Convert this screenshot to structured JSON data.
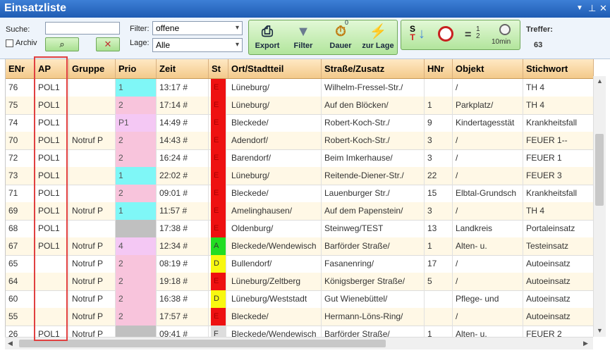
{
  "window": {
    "title": "Einsatzliste",
    "dropdown_glyph": "▼",
    "pin_glyph": "⊥",
    "close_glyph": "✕"
  },
  "toolbar": {
    "suche_label": "Suche:",
    "suche_value": "",
    "archiv_label": "Archiv",
    "filter_label": "Filter:",
    "filter_value": "offene",
    "lage_label": "Lage:",
    "lage_value": "Alle",
    "buttons": [
      {
        "label": "Export",
        "icon": "printer-icon"
      },
      {
        "label": "Filter",
        "icon": "funnel-icon"
      },
      {
        "label": "Dauer",
        "icon": "stopwatch-icon",
        "badge": "0"
      },
      {
        "label": "zur Lage",
        "icon": "lightning-icon"
      }
    ],
    "icon_buttons": [
      {
        "icon": "sort-status-icon",
        "letters": "S T"
      },
      {
        "icon": "alarm-clock-icon"
      },
      {
        "icon": "count-icon",
        "text": "1 2"
      },
      {
        "icon": "timer-icon",
        "text": "10min"
      }
    ],
    "treffer_label": "Treffer:",
    "treffer_value": "63"
  },
  "colors": {
    "prio_cyan": "#7ff7f7",
    "prio_pink": "#f8c4dc",
    "prio_violet": "#f4c8f4",
    "prio_gray": "#c0c0c0",
    "st_red": "#ee1111",
    "st_green": "#22dd22",
    "st_yellow": "#f8f811",
    "st_lightgray": "#dddddd"
  },
  "table": {
    "columns": [
      "ENr",
      "AP",
      "Gruppe",
      "Prio",
      "Zeit",
      "St",
      "Ort/Stadtteil",
      "Straße/Zusatz",
      "HNr",
      "Objekt",
      "Stichwort"
    ],
    "rows": [
      {
        "enr": "76",
        "ap": "POL1",
        "gruppe": "",
        "prio": "1",
        "prio_color": "#7ff7f7",
        "zeit": "13:17 #",
        "st": "E",
        "st_color": "#ee1111",
        "ort": "Lüneburg/",
        "strasse": "Wilhelm-Fressel-Str./",
        "hnr": "",
        "objekt": "/",
        "stichwort": "TH 4"
      },
      {
        "enr": "75",
        "ap": "POL1",
        "gruppe": "",
        "prio": "2",
        "prio_color": "#f8c4dc",
        "zeit": "17:14 #",
        "st": "E",
        "st_color": "#ee1111",
        "ort": "Lüneburg/",
        "strasse": "Auf den Blöcken/",
        "hnr": "1",
        "objekt": "Parkplatz/",
        "stichwort": "TH 4"
      },
      {
        "enr": "74",
        "ap": "POL1",
        "gruppe": "",
        "prio": "P1",
        "prio_color": "#f4c8f4",
        "zeit": "14:49 #",
        "st": "E",
        "st_color": "#ee1111",
        "ort": "Bleckede/",
        "strasse": "Robert-Koch-Str./",
        "hnr": "9",
        "objekt": "Kindertagesstät",
        "stichwort": "Krankheitsfall"
      },
      {
        "enr": "70",
        "ap": "POL1",
        "gruppe": "Notruf P",
        "prio": "2",
        "prio_color": "#f8c4dc",
        "zeit": "14:43 #",
        "st": "E",
        "st_color": "#ee1111",
        "ort": "Adendorf/",
        "strasse": "Robert-Koch-Str./",
        "hnr": "3",
        "objekt": "/",
        "stichwort": "FEUER 1--"
      },
      {
        "enr": "72",
        "ap": "POL1",
        "gruppe": "",
        "prio": "2",
        "prio_color": "#f8c4dc",
        "zeit": "16:24 #",
        "st": "E",
        "st_color": "#ee1111",
        "ort": "Barendorf/",
        "strasse": "Beim Imkerhause/",
        "hnr": "3",
        "objekt": "/",
        "stichwort": "FEUER 1"
      },
      {
        "enr": "73",
        "ap": "POL1",
        "gruppe": "",
        "prio": "1",
        "prio_color": "#7ff7f7",
        "zeit": "22:02 #",
        "st": "E",
        "st_color": "#ee1111",
        "ort": "Lüneburg/",
        "strasse": "Reitende-Diener-Str./",
        "hnr": "22",
        "objekt": "/",
        "stichwort": "FEUER 3"
      },
      {
        "enr": "71",
        "ap": "POL1",
        "gruppe": "",
        "prio": "2",
        "prio_color": "#f8c4dc",
        "zeit": "09:01 #",
        "st": "E",
        "st_color": "#ee1111",
        "ort": "Bleckede/",
        "strasse": "Lauenburger Str./",
        "hnr": "15",
        "objekt": "Elbtal-Grundsch",
        "stichwort": "Krankheitsfall"
      },
      {
        "enr": "69",
        "ap": "POL1",
        "gruppe": "Notruf P",
        "prio": "1",
        "prio_color": "#7ff7f7",
        "zeit": "11:57 #",
        "st": "E",
        "st_color": "#ee1111",
        "ort": "Amelinghausen/",
        "strasse": "Auf dem Papenstein/",
        "hnr": "3",
        "objekt": "/",
        "stichwort": "TH 4"
      },
      {
        "enr": "68",
        "ap": "POL1",
        "gruppe": "",
        "prio": "",
        "prio_color": "#c0c0c0",
        "zeit": "17:38 #",
        "st": "E",
        "st_color": "#ee1111",
        "ort": "Oldenburg/",
        "strasse": "Steinweg/TEST",
        "hnr": "13",
        "objekt": "Landkreis",
        "stichwort": "Portaleinsatz"
      },
      {
        "enr": "67",
        "ap": "POL1",
        "gruppe": "Notruf P",
        "prio": "4",
        "prio_color": "#f4c8f4",
        "zeit": "12:34 #",
        "st": "A",
        "st_color": "#22dd22",
        "ort": "Bleckede/Wendewisch",
        "strasse": "Barförder Straße/",
        "hnr": "1",
        "objekt": "Alten- u.",
        "stichwort": "Testeinsatz"
      },
      {
        "enr": "65",
        "ap": "",
        "gruppe": "Notruf P",
        "prio": "2",
        "prio_color": "#f8c4dc",
        "zeit": "08:19 #",
        "st": "D",
        "st_color": "#f8f811",
        "ort": "Bullendorf/",
        "strasse": "Fasanenring/",
        "hnr": "17",
        "objekt": "/",
        "stichwort": "Autoeinsatz"
      },
      {
        "enr": "64",
        "ap": "",
        "gruppe": "Notruf P",
        "prio": "2",
        "prio_color": "#f8c4dc",
        "zeit": "19:18 #",
        "st": "E",
        "st_color": "#ee1111",
        "ort": "Lüneburg/Zeltberg",
        "strasse": "Königsberger Straße/",
        "hnr": "5",
        "objekt": "/",
        "stichwort": "Autoeinsatz"
      },
      {
        "enr": "60",
        "ap": "",
        "gruppe": "Notruf P",
        "prio": "2",
        "prio_color": "#f8c4dc",
        "zeit": "16:38 #",
        "st": "D",
        "st_color": "#f8f811",
        "ort": "Lüneburg/Weststadt",
        "strasse": "Gut Wienebüttel/",
        "hnr": "",
        "objekt": "Pflege- und",
        "stichwort": "Autoeinsatz"
      },
      {
        "enr": "55",
        "ap": "",
        "gruppe": "Notruf P",
        "prio": "2",
        "prio_color": "#f8c4dc",
        "zeit": "17:57 #",
        "st": "E",
        "st_color": "#ee1111",
        "ort": "Bleckede/",
        "strasse": "Hermann-Löns-Ring/",
        "hnr": "",
        "objekt": "/",
        "stichwort": "Autoeinsatz"
      },
      {
        "enr": "26",
        "ap": "POL1",
        "gruppe": "Notruf P",
        "prio": "",
        "prio_color": "#c0c0c0",
        "zeit": "09:41 #",
        "st": "F",
        "st_color": "#dddddd",
        "ort": "Bleckede/Wendewisch",
        "strasse": "Barförder Straße/",
        "hnr": "1",
        "objekt": "Alten- u.",
        "stichwort": "FEUER 2"
      }
    ]
  }
}
